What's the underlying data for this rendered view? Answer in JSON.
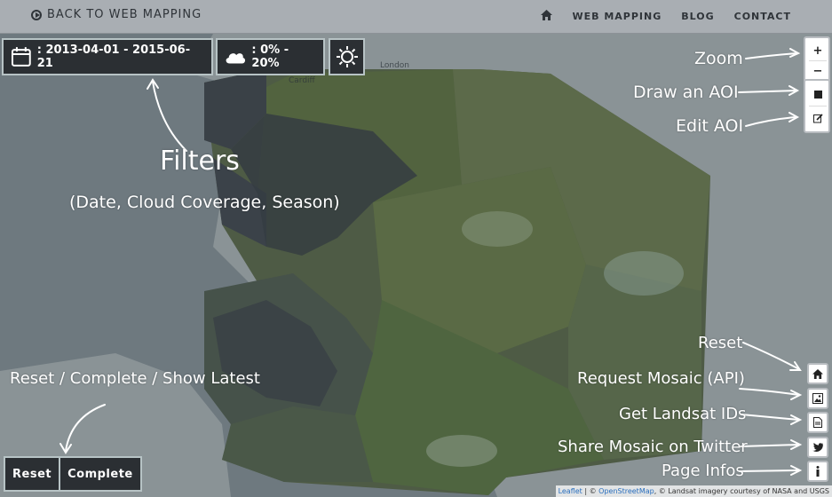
{
  "topbar": {
    "back_label": "BACK TO WEB MAPPING",
    "nav": {
      "home_icon": "home-icon",
      "web_mapping": "WEB MAPPING",
      "blog": "BLOG",
      "contact": "CONTACT"
    }
  },
  "filters": {
    "date": ": 2013-04-01 - 2015-06-21",
    "cloud": ": 0% - 20%",
    "icons": {
      "date": "calendar-icon",
      "cloud": "cloud-icon",
      "season": "sun-icon"
    }
  },
  "map_places": {
    "london": "London",
    "cardiff": "Cardiff"
  },
  "controls": {
    "zoom_in": "+",
    "zoom_out": "−",
    "draw_icon": "square-icon",
    "edit_icon": "edit-icon",
    "reset_icon": "home-icon",
    "request_icon": "image-icon",
    "ids_icon": "document-icon",
    "twitter_icon": "twitter-icon",
    "info_icon": "info-icon"
  },
  "bottom_buttons": {
    "reset": "Reset",
    "complete": "Complete"
  },
  "annotations": {
    "zoom": "Zoom",
    "draw_aoi": "Draw an AOI",
    "edit_aoi": "Edit AOI",
    "filters": "Filters",
    "filters_sub": "(Date, Cloud Coverage, Season)",
    "reset_complete": "Reset / Complete / Show Latest",
    "reset": "Reset",
    "request_mosaic": "Request Mosaic (API)",
    "get_ids": "Get Landsat IDs",
    "share_twitter": "Share Mosaic on Twitter",
    "page_infos": "Page Infos"
  },
  "attribution": {
    "leaflet": "Leaflet",
    "sep1": " | © ",
    "osm": "OpenStreetMap",
    "rest": ", © Landsat imagery courtesy of NASA and USGS"
  },
  "colors": {
    "topbar": "#a9aeb3",
    "panel": "#2b2f33",
    "panel_border": "#b7c3c5",
    "sea": "#6e797f"
  }
}
